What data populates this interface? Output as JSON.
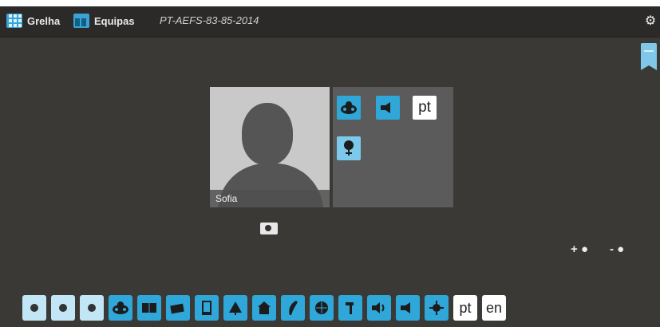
{
  "topbar": {
    "nav": [
      {
        "label": "Grelha",
        "icon": "grid-icon"
      },
      {
        "label": "Equipas",
        "icon": "teams-icon"
      }
    ],
    "session_id": "PT-AEFS-83-85-2014",
    "settings_icon": "gear-icon"
  },
  "profile": {
    "name": "Sofia",
    "camera_icon": "camera-icon"
  },
  "attributes": {
    "tiles": [
      {
        "icon": "ladybug-icon"
      },
      {
        "icon": "speaker-icon"
      },
      {
        "text": "pt"
      },
      {
        "icon": "pin-icon"
      }
    ]
  },
  "actions": {
    "add_label": "+",
    "remove_label": "-"
  },
  "palette": {
    "tiles": [
      {
        "icon": "female-icon"
      },
      {
        "icon": "male-icon"
      },
      {
        "icon": "neutral-icon"
      },
      {
        "icon": "ladybug-icon"
      },
      {
        "icon": "book-icon"
      },
      {
        "icon": "cards-icon"
      },
      {
        "icon": "tablet-icon"
      },
      {
        "icon": "tree-icon"
      },
      {
        "icon": "house-icon"
      },
      {
        "icon": "feather-icon"
      },
      {
        "icon": "globe-icon"
      },
      {
        "icon": "hammer-icon"
      },
      {
        "icon": "speaker-loud-icon"
      },
      {
        "icon": "speaker-icon"
      },
      {
        "icon": "sun-icon"
      },
      {
        "text": "pt"
      },
      {
        "text": "en"
      }
    ]
  },
  "colors": {
    "accent_blue": "#2fa7d9",
    "light_blue": "#c2e6f6",
    "background": "#3a3936",
    "topbar": "#2b2a28"
  }
}
